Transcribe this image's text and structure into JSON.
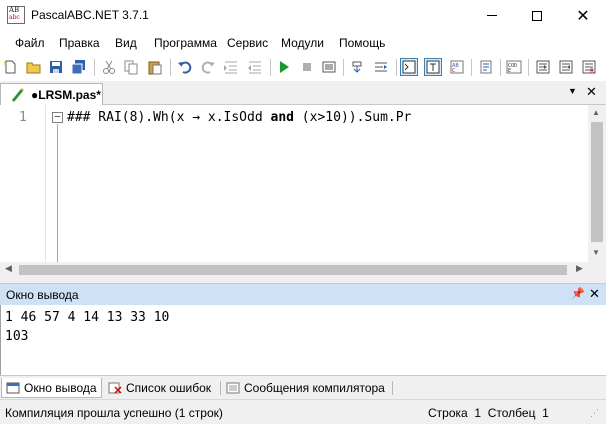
{
  "window": {
    "title": "PascalABC.NET 3.7.1",
    "icon_top": "AB",
    "icon_bottom": "abc"
  },
  "menu": [
    "Файл",
    "Правка",
    "Вид",
    "Программа",
    "Сервис",
    "Модули",
    "Помощь"
  ],
  "toolbar": {
    "icons": [
      "new-file-icon",
      "open-folder-icon",
      "save-icon",
      "save-all-icon",
      "cut-icon",
      "copy-icon",
      "paste-icon",
      "undo-icon",
      "redo-icon",
      "indent-icon",
      "unindent-icon",
      "run-icon",
      "stop-icon",
      "compile-icon",
      "debug-step-icon",
      "step-over-icon",
      "console-output-icon",
      "text-output-icon",
      "format-icon",
      "code-template-icon",
      "code-icon",
      "step-into-icon",
      "step-out-icon",
      "run-to-cursor-icon"
    ],
    "accent_run": "#1a9a2a",
    "accent_select": "#3c7fb1"
  },
  "editor": {
    "tab_label": "●LRSM.pas*",
    "line_number": "1",
    "code": {
      "part1": "### RAI(8).Wh(x → x.IsOdd ",
      "keyword": "and",
      "part2": " (x>10)).Sum.Pr"
    }
  },
  "output_panel": {
    "title": "Окно вывода",
    "lines": [
      "1 46 57 4 14 13 33 10",
      "103"
    ],
    "header_color": "#cfe1f5"
  },
  "bottom_tabs": [
    "Окно вывода",
    "Список ошибок",
    "Сообщения компилятора"
  ],
  "status": {
    "message": "Компиляция прошла успешно (1 строк)",
    "row_label": "Строка",
    "row": "1",
    "col_label": "Столбец",
    "col": "1"
  }
}
